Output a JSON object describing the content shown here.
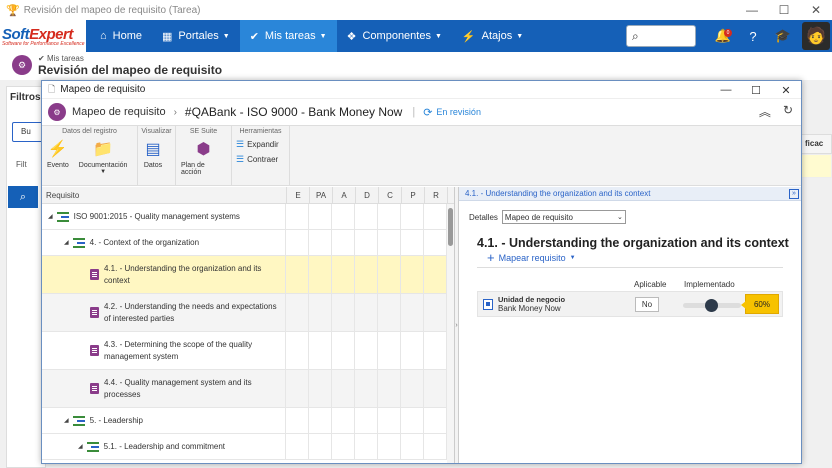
{
  "window": {
    "title": "Revisión del mapeo de requisito (Tarea)"
  },
  "logo": {
    "soft": "Soft",
    "expert": "Expert",
    "tagline": "Software for Performance Excellence"
  },
  "nav": {
    "items": [
      {
        "label": "Home"
      },
      {
        "label": "Portales"
      },
      {
        "label": "Mis tareas"
      },
      {
        "label": "Componentes"
      },
      {
        "label": "Atajos"
      }
    ],
    "notification_count": "0"
  },
  "page": {
    "breadcrumb": "Mis tareas",
    "title": "Revisión del mapeo de requisito"
  },
  "background": {
    "filters": "Filtros",
    "search_stub": "Bu",
    "filters2": "Filt",
    "right_col": "ficac"
  },
  "modal": {
    "title": "Mapeo de requisito",
    "breadcrumb": "Mapeo de requisito",
    "record": "#QABank - ISO 9000 - Bank Money Now",
    "status": "En revisión",
    "toolbar": {
      "groups": [
        {
          "title": "Datos del registro",
          "buttons": [
            {
              "label": "Evento"
            },
            {
              "label": "Documentación"
            }
          ]
        },
        {
          "title": "Visualizar",
          "buttons": [
            {
              "label": "Datos"
            }
          ]
        },
        {
          "title": "SE Suite",
          "buttons": [
            {
              "label": "Plan de acción"
            }
          ]
        },
        {
          "title": "Herramientas",
          "buttons": [
            {
              "label": "Expandir"
            },
            {
              "label": "Contraer"
            }
          ]
        }
      ]
    },
    "grid": {
      "columns": [
        "Requisito",
        "E",
        "PA",
        "A",
        "D",
        "C",
        "P",
        "R"
      ],
      "rows": [
        {
          "label": "ISO 9001:2015 - Quality management systems"
        },
        {
          "label": "4. - Context of the organization"
        },
        {
          "label": "4.1. - Understanding the organization and its context"
        },
        {
          "label": "4.2. - Understanding the needs and expectations of interested parties"
        },
        {
          "label": "4.3. - Determining the scope of the quality management system"
        },
        {
          "label": "4.4. - Quality management system and its processes"
        },
        {
          "label": "5. - Leadership"
        },
        {
          "label": "5.1. - Leadership and commitment"
        }
      ]
    },
    "detail": {
      "header": "4.1. - Understanding the organization and its context",
      "details_label": "Detalles",
      "details_select": "Mapeo de requisito",
      "title": "4.1. - Understanding the organization and its context",
      "map_link": "Mapear requisito",
      "col_aplicable": "Aplicable",
      "col_implementado": "Implementado",
      "unit_label": "Unidad de negocio",
      "unit_value": "Bank Money Now",
      "aplicable_value": "No",
      "implementado_value": "60%",
      "implementado_fraction": 0.6
    }
  }
}
